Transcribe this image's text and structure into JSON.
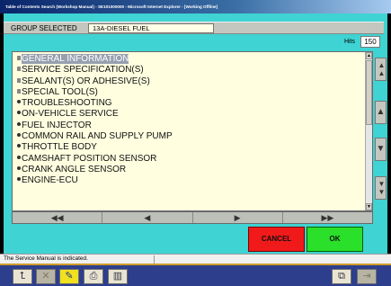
{
  "window": {
    "title": "Table of Contents Search (Workshop Manual) - SE101000000 - Microsoft Internet Explorer - [Working Offline]"
  },
  "group": {
    "label": "GROUP SELECTED",
    "value": "13A-DIESEL FUEL"
  },
  "hits": {
    "label": "Hits",
    "value": "150"
  },
  "list": {
    "items": [
      {
        "label": "GENERAL INFORMATION",
        "bullet": "square",
        "selected": true
      },
      {
        "label": "SERVICE SPECIFICATION(S)",
        "bullet": "square",
        "selected": false
      },
      {
        "label": "SEALANT(S) OR ADHESIVE(S)",
        "bullet": "square",
        "selected": false
      },
      {
        "label": "SPECIAL TOOL(S)",
        "bullet": "square",
        "selected": false
      },
      {
        "label": "TROUBLESHOOTING",
        "bullet": "dot",
        "selected": false
      },
      {
        "label": "ON-VEHICLE SERVICE",
        "bullet": "dot",
        "selected": false
      },
      {
        "label": "FUEL INJECTOR",
        "bullet": "dot",
        "selected": false
      },
      {
        "label": "COMMON RAIL AND SUPPLY PUMP",
        "bullet": "dot",
        "selected": false
      },
      {
        "label": "THROTTLE BODY",
        "bullet": "dot",
        "selected": false
      },
      {
        "label": "CAMSHAFT POSITION SENSOR",
        "bullet": "dot",
        "selected": false
      },
      {
        "label": "CRANK ANGLE SENSOR",
        "bullet": "dot",
        "selected": false
      },
      {
        "label": "ENGINE-ECU",
        "bullet": "dot",
        "selected": false
      }
    ]
  },
  "nav": {
    "first": "◀◀",
    "prev": "◀",
    "next": "▶",
    "last": "▶▶"
  },
  "side": {
    "top": "▲▲",
    "page_up": "▲",
    "page_down": "▼",
    "bottom": "▼▼"
  },
  "buttons": {
    "cancel": "CANCEL",
    "ok": "OK"
  },
  "colors": {
    "background": "#3fd3d3",
    "cancel": "#f01a1a",
    "ok": "#2ae02a",
    "list_bg": "#ffffe0",
    "toolbar": "#2d3e8c"
  },
  "status": {
    "text": "The Service Manual is indicated."
  },
  "toolbar": {
    "icons": [
      "up-arrow-icon",
      "close-x-icon",
      "highlight-icon",
      "print-icon",
      "book-icon",
      "zoom-screen-icon",
      "exit-icon"
    ]
  }
}
